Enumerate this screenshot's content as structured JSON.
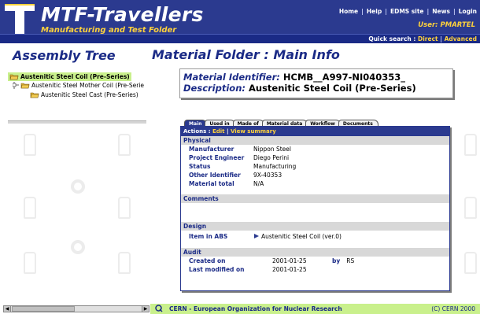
{
  "app": {
    "title": "MTF-Travellers",
    "subtitle": "Manufacturing and Test Folder"
  },
  "topnav": {
    "items": [
      "Home",
      "Help",
      "EDMS site",
      "News",
      "Login"
    ]
  },
  "user": "User: PMARTEL",
  "quick_search": {
    "label": "Quick search :",
    "direct": "Direct",
    "advanced": "Advanced"
  },
  "assembly": {
    "title": "Assembly Tree",
    "items": [
      {
        "label": "Austenitic Steel Coil (Pre-Series)"
      },
      {
        "label": "Austenitic Steel Mother Coil (Pre-Serie"
      },
      {
        "label": "Austenitic Steel Cast (Pre-Series)"
      }
    ]
  },
  "main": {
    "title": "Material Folder : Main Info",
    "identifier_label": "Material Identifier:",
    "identifier_value": "HCMB__A997-NI040353_",
    "description_label": "Description:",
    "description_value": "Austenitic Steel Coil (Pre-Series)",
    "tabs": [
      "Main",
      "Used in",
      "Made of",
      "Material data",
      "Workflow",
      "Documents"
    ],
    "actions": {
      "label": "Actions :",
      "edit": "Edit",
      "view_summary": "View summary"
    },
    "sections": {
      "physical": "Physical",
      "comments": "Comments",
      "design": "Design",
      "audit": "Audit"
    },
    "physical": {
      "manufacturer_label": "Manufacturer",
      "manufacturer_value": "Nippon Steel",
      "engineer_label": "Project Engineer",
      "engineer_value": "Diego Perini",
      "status_label": "Status",
      "status_value": "Manufacturing",
      "other_id_label": "Other Identifier",
      "other_id_value": "9X-40353",
      "total_label": "Material total",
      "total_value": "N/A"
    },
    "design": {
      "item_label": "Item in ABS",
      "item_value": "Austenitic Steel Coil (ver.0)"
    },
    "audit": {
      "created_label": "Created on",
      "created_value": "2001-01-25",
      "by_label": "by",
      "by_value": "RS",
      "modified_label": "Last modified on",
      "modified_value": "2001-01-25"
    }
  },
  "footer": {
    "text": "CERN - European Organization for Nuclear Research",
    "copyright": "(C) CERN 2000"
  },
  "colors": {
    "header": "#2b3a8f",
    "accent_yellow": "#ffd23c",
    "highlight_green": "#c9f08c",
    "title_blue": "#1a2a86"
  }
}
